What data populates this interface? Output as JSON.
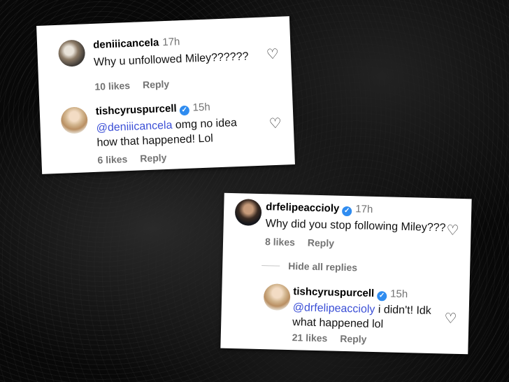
{
  "card1": {
    "comment": {
      "username": "deniiicancela",
      "time": "17h",
      "text": "Why u unfollowed Miley??????",
      "likes": "10 likes",
      "reply": "Reply",
      "heart_icon": "heart-outline-icon"
    },
    "reply": {
      "username": "tishcyruspurcell",
      "time": "15h",
      "mention": "@deniiicancela",
      "text_line1": " omg no idea",
      "text_line2": "how that happened! Lol",
      "likes": "6 likes",
      "reply": "Reply",
      "verified_icon": "verified-badge-icon",
      "heart_icon": "heart-outline-icon"
    }
  },
  "card2": {
    "comment": {
      "username": "drfelipeaccioly",
      "time": "17h",
      "text": "Why did you stop following Miley???",
      "likes": "8 likes",
      "reply": "Reply",
      "verified_icon": "verified-badge-icon",
      "heart_icon": "heart-outline-icon"
    },
    "hide_replies": "Hide all replies",
    "reply": {
      "username": "tishcyruspurcell",
      "time": "15h",
      "mention": "@drfelipeaccioly",
      "text_line1": " i didn't! Idk",
      "text_line2": "what happened lol",
      "likes": "21 likes",
      "reply": "Reply",
      "verified_icon": "verified-badge-icon",
      "heart_icon": "heart-outline-icon"
    }
  },
  "colors": {
    "mention": "#3b4fd6",
    "verified": "#2f8cf0",
    "meta": "#737373",
    "background": "#080808"
  }
}
